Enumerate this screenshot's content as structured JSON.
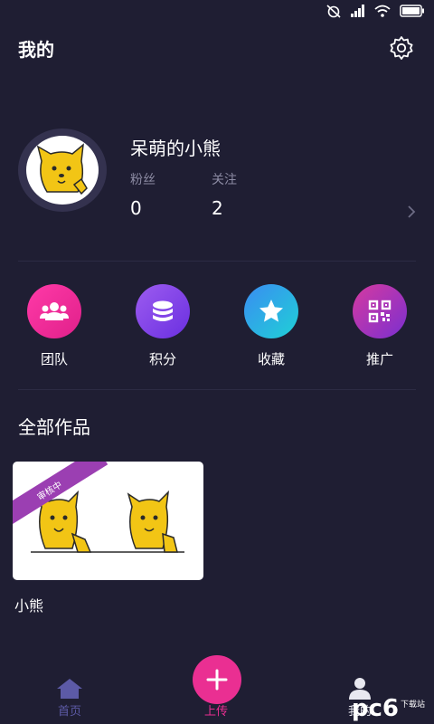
{
  "header": {
    "title": "我的"
  },
  "profile": {
    "nickname": "呆萌的小熊",
    "stats": [
      {
        "label": "粉丝",
        "value": "0"
      },
      {
        "label": "关注",
        "value": "2"
      }
    ]
  },
  "quick_actions": [
    {
      "label": "团队",
      "icon": "team-icon",
      "color_from": "#ff3aa8",
      "color_to": "#e0208a"
    },
    {
      "label": "积分",
      "icon": "coins-icon",
      "color_from": "#9d5cf0",
      "color_to": "#6a2fe0"
    },
    {
      "label": "收藏",
      "icon": "star-icon",
      "color_from": "#3a8cf2",
      "color_to": "#1fd1d6"
    },
    {
      "label": "推广",
      "icon": "qrcode-icon",
      "color_from": "#d63aa0",
      "color_to": "#7a2fd0"
    }
  ],
  "works": {
    "section_title": "全部作品",
    "items": [
      {
        "title": "小熊",
        "status": "审核中"
      }
    ]
  },
  "bottom_nav": {
    "home": "首页",
    "upload": "上传",
    "mine": "我的"
  },
  "watermark": {
    "text": "pc6",
    "sub": "下载站"
  },
  "colors": {
    "background": "#1f1e33",
    "accent": "#ea2f92",
    "muted": "#8c8ba3",
    "nav_inactive": "#5c5aa6"
  }
}
